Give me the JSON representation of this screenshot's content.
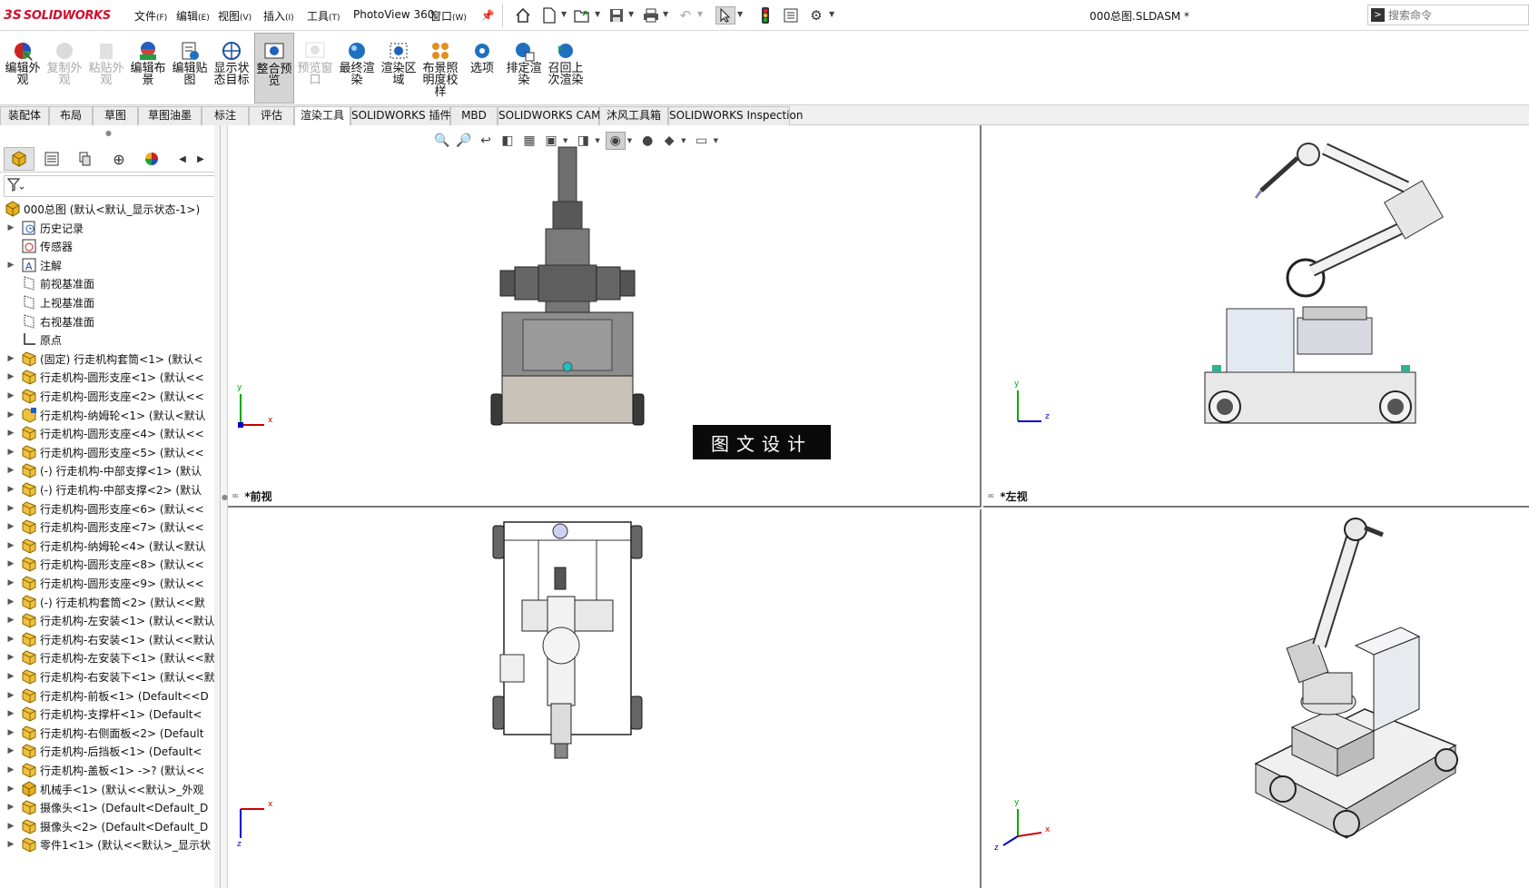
{
  "app": {
    "name": "SOLIDWORKS",
    "ds_mark": "3S"
  },
  "menus": [
    {
      "label": "文件",
      "key": "(F)"
    },
    {
      "label": "编辑",
      "key": "(E)"
    },
    {
      "label": "视图",
      "key": "(V)"
    },
    {
      "label": "插入",
      "key": "(I)"
    },
    {
      "label": "工具",
      "key": "(T)"
    },
    {
      "label": "PhotoView 360",
      "key": ""
    },
    {
      "label": "窗口",
      "key": "(W)"
    }
  ],
  "document_title": "000总图.SLDASM *",
  "search": {
    "placeholder": "搜索命令"
  },
  "ribbon": [
    {
      "label": "编辑外观",
      "enabled": true,
      "icon": "edit-appearance-icon"
    },
    {
      "label": "复制外观",
      "enabled": false,
      "icon": "copy-appearance-icon"
    },
    {
      "label": "粘贴外观",
      "enabled": false,
      "icon": "paste-appearance-icon"
    },
    {
      "label": "编辑布景",
      "enabled": true,
      "icon": "edit-scene-icon"
    },
    {
      "label": "编辑贴图",
      "enabled": true,
      "icon": "edit-decal-icon"
    },
    {
      "label": "显示状态目标",
      "enabled": true,
      "icon": "display-state-target-icon"
    },
    {
      "label": "整合预览",
      "enabled": true,
      "active": true,
      "icon": "integrated-preview-icon"
    },
    {
      "label": "预览窗口",
      "enabled": false,
      "icon": "preview-window-icon"
    },
    {
      "label": "最终渲染",
      "enabled": true,
      "icon": "final-render-icon"
    },
    {
      "label": "渲染区域",
      "enabled": true,
      "icon": "render-region-icon"
    },
    {
      "label": "布景照明度校样",
      "enabled": true,
      "icon": "scene-illumination-proof-icon"
    },
    {
      "label": "选项",
      "enabled": true,
      "icon": "options-icon"
    },
    {
      "label": "排定渲染",
      "enabled": true,
      "icon": "schedule-render-icon"
    },
    {
      "label": "召回上次渲染",
      "enabled": true,
      "icon": "recall-last-render-icon"
    }
  ],
  "tabs": [
    {
      "label": "装配体",
      "active": false
    },
    {
      "label": "布局",
      "active": false
    },
    {
      "label": "草图",
      "active": false
    },
    {
      "label": "草图油墨",
      "active": false
    },
    {
      "label": "标注",
      "active": false
    },
    {
      "label": "评估",
      "active": false
    },
    {
      "label": "渲染工具",
      "active": true
    },
    {
      "label": "SOLIDWORKS 插件",
      "active": false
    },
    {
      "label": "MBD",
      "active": false
    },
    {
      "label": "SOLIDWORKS CAM",
      "active": false
    },
    {
      "label": "沐风工具箱",
      "active": false
    },
    {
      "label": "SOLIDWORKS Inspection",
      "active": false
    }
  ],
  "tree": {
    "root": "000总图  (默认<默认_显示状态-1>)",
    "items": [
      {
        "label": "历史记录",
        "type": "history",
        "expand": true
      },
      {
        "label": "传感器",
        "type": "sensor",
        "expand": false
      },
      {
        "label": "注解",
        "type": "annotation",
        "expand": true
      },
      {
        "label": "前视基准面",
        "type": "plane",
        "expand": false
      },
      {
        "label": "上视基准面",
        "type": "plane",
        "expand": false
      },
      {
        "label": "右视基准面",
        "type": "plane",
        "expand": false
      },
      {
        "label": "原点",
        "type": "origin",
        "expand": false
      },
      {
        "label": "(固定) 行走机构套筒<1> (默认<",
        "type": "part",
        "expand": true
      },
      {
        "label": "行走机构-圆形支座<1> (默认<<",
        "type": "part",
        "expand": true
      },
      {
        "label": "行走机构-圆形支座<2> (默认<<",
        "type": "part",
        "expand": true
      },
      {
        "label": "行走机构-纳姆轮<1> (默认<默认",
        "type": "part-edit",
        "expand": true
      },
      {
        "label": "行走机构-圆形支座<4> (默认<<",
        "type": "part",
        "expand": true
      },
      {
        "label": "行走机构-圆形支座<5> (默认<<",
        "type": "part",
        "expand": true
      },
      {
        "label": "(-) 行走机构-中部支撑<1> (默认",
        "type": "part",
        "expand": true
      },
      {
        "label": "(-) 行走机构-中部支撑<2> (默认",
        "type": "part",
        "expand": true
      },
      {
        "label": "行走机构-圆形支座<6> (默认<<",
        "type": "part",
        "expand": true
      },
      {
        "label": "行走机构-圆形支座<7> (默认<<",
        "type": "part",
        "expand": true
      },
      {
        "label": "行走机构-纳姆轮<4> (默认<默认",
        "type": "part",
        "expand": true
      },
      {
        "label": "行走机构-圆形支座<8> (默认<<",
        "type": "part",
        "expand": true
      },
      {
        "label": "行走机构-圆形支座<9> (默认<<",
        "type": "part",
        "expand": true
      },
      {
        "label": "(-) 行走机构套筒<2> (默认<<默",
        "type": "part",
        "expand": true
      },
      {
        "label": "行走机构-左安装<1> (默认<<默认",
        "type": "part",
        "expand": true
      },
      {
        "label": "行走机构-右安装<1> (默认<<默认",
        "type": "part",
        "expand": true
      },
      {
        "label": "行走机构-左安装下<1> (默认<<默",
        "type": "part",
        "expand": true
      },
      {
        "label": "行走机构-右安装下<1> (默认<<默",
        "type": "part",
        "expand": true
      },
      {
        "label": "行走机构-前板<1> (Default<<D",
        "type": "part",
        "expand": true
      },
      {
        "label": "行走机构-支撑杆<1> (Default<",
        "type": "part",
        "expand": true
      },
      {
        "label": "行走机构-右侧面板<2> (Default",
        "type": "part",
        "expand": true
      },
      {
        "label": "行走机构-后挡板<1> (Default<",
        "type": "part",
        "expand": true
      },
      {
        "label": "行走机构-盖板<1> ->? (默认<<",
        "type": "part",
        "expand": true
      },
      {
        "label": "机械手<1> (默认<<默认>_外观",
        "type": "assembly",
        "expand": true
      },
      {
        "label": "摄像头<1> (Default<Default_D",
        "type": "part",
        "expand": true
      },
      {
        "label": "摄像头<2> (Default<Default_D",
        "type": "part",
        "expand": true
      },
      {
        "label": "零件1<1> (默认<<默认>_显示状",
        "type": "part",
        "expand": true
      }
    ]
  },
  "viewports": {
    "front": {
      "label": "*前视",
      "axes": [
        "y",
        "x"
      ]
    },
    "left": {
      "label": "*左视",
      "axes": [
        "y",
        "z"
      ]
    },
    "top": {
      "label": "",
      "axes": [
        "x",
        "z"
      ]
    },
    "iso": {
      "label": "",
      "axes": [
        "y",
        "x",
        "z"
      ]
    }
  },
  "watermark": "图文设计",
  "colors": {
    "brand_red": "#cf102d",
    "part_yellow": "#e8b020",
    "axis_x": "#cc0000",
    "axis_y": "#00aa00",
    "axis_z": "#0000cc"
  }
}
